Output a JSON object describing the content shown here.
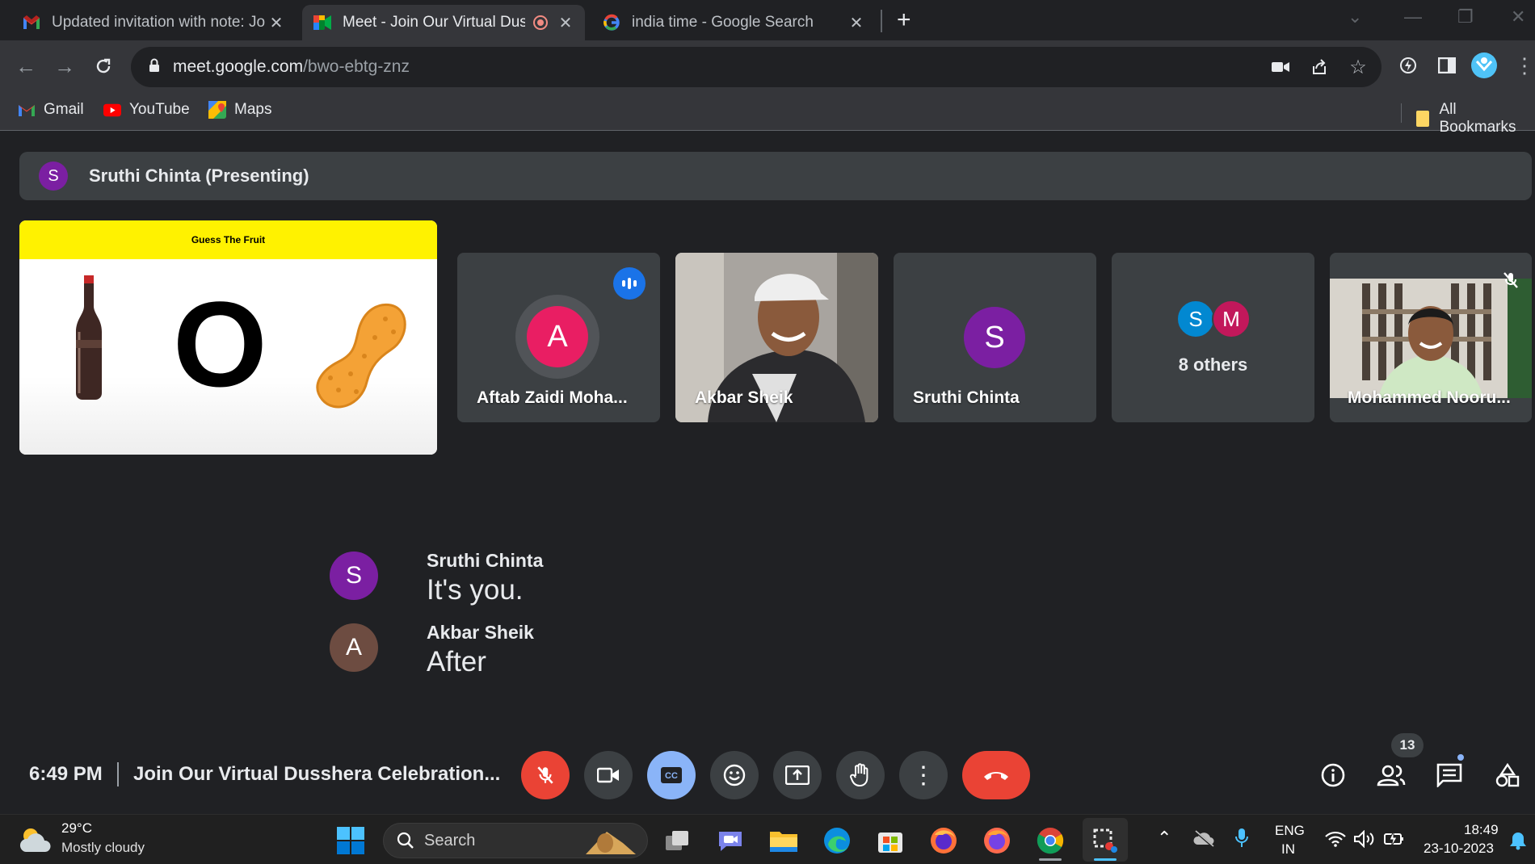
{
  "browser": {
    "tabs": [
      {
        "title": "Updated invitation with note: Jo",
        "icon": "gmail-icon"
      },
      {
        "title": "Meet - Join Our Virtual Dus",
        "icon": "google-meet-icon",
        "recording": true
      },
      {
        "title": "india time - Google Search",
        "icon": "google-icon"
      }
    ],
    "url_host": "meet.google.com",
    "url_path": "/bwo-ebtg-znz",
    "bookmarks": [
      {
        "label": "Gmail",
        "icon": "gmail-icon"
      },
      {
        "label": "YouTube",
        "icon": "youtube-icon"
      },
      {
        "label": "Maps",
        "icon": "maps-icon"
      }
    ],
    "all_bookmarks": "All Bookmarks"
  },
  "meet": {
    "presenter_initial": "S",
    "presenter_banner": "Sruthi Chinta (Presenting)",
    "slide": {
      "title": "Guess The Fruit",
      "letter": "O"
    },
    "participants": [
      {
        "name": "Aftab Zaidi Moha...",
        "initial": "A",
        "color": "#e91e63",
        "speaking": true
      },
      {
        "name": "Akbar Sheik",
        "video": true
      },
      {
        "name": "Sruthi Chinta",
        "initial": "S",
        "color": "#7b1fa2"
      },
      {
        "name": "8 others",
        "initials": [
          "S",
          "M"
        ],
        "colors": [
          "#0288d1",
          "#c2185b"
        ]
      },
      {
        "name": "Mohammed Nooru...",
        "video": true,
        "muted": true
      }
    ],
    "captions": [
      {
        "initial": "S",
        "speaker": "Sruthi Chinta",
        "text": "It's you.",
        "color": "#7b1fa2"
      },
      {
        "initial": "A",
        "speaker": "Akbar Sheik",
        "text": "After",
        "color": "#6d4c41"
      }
    ],
    "time": "6:49 PM",
    "meeting_title": "Join Our Virtual Dusshera Celebration...",
    "people_count": "13"
  },
  "taskbar": {
    "weather_temp": "29°C",
    "weather_desc": "Mostly cloudy",
    "search_placeholder": "Search",
    "lang_1": "ENG",
    "lang_2": "IN",
    "clock_time": "18:49",
    "clock_date": "23-10-2023"
  }
}
